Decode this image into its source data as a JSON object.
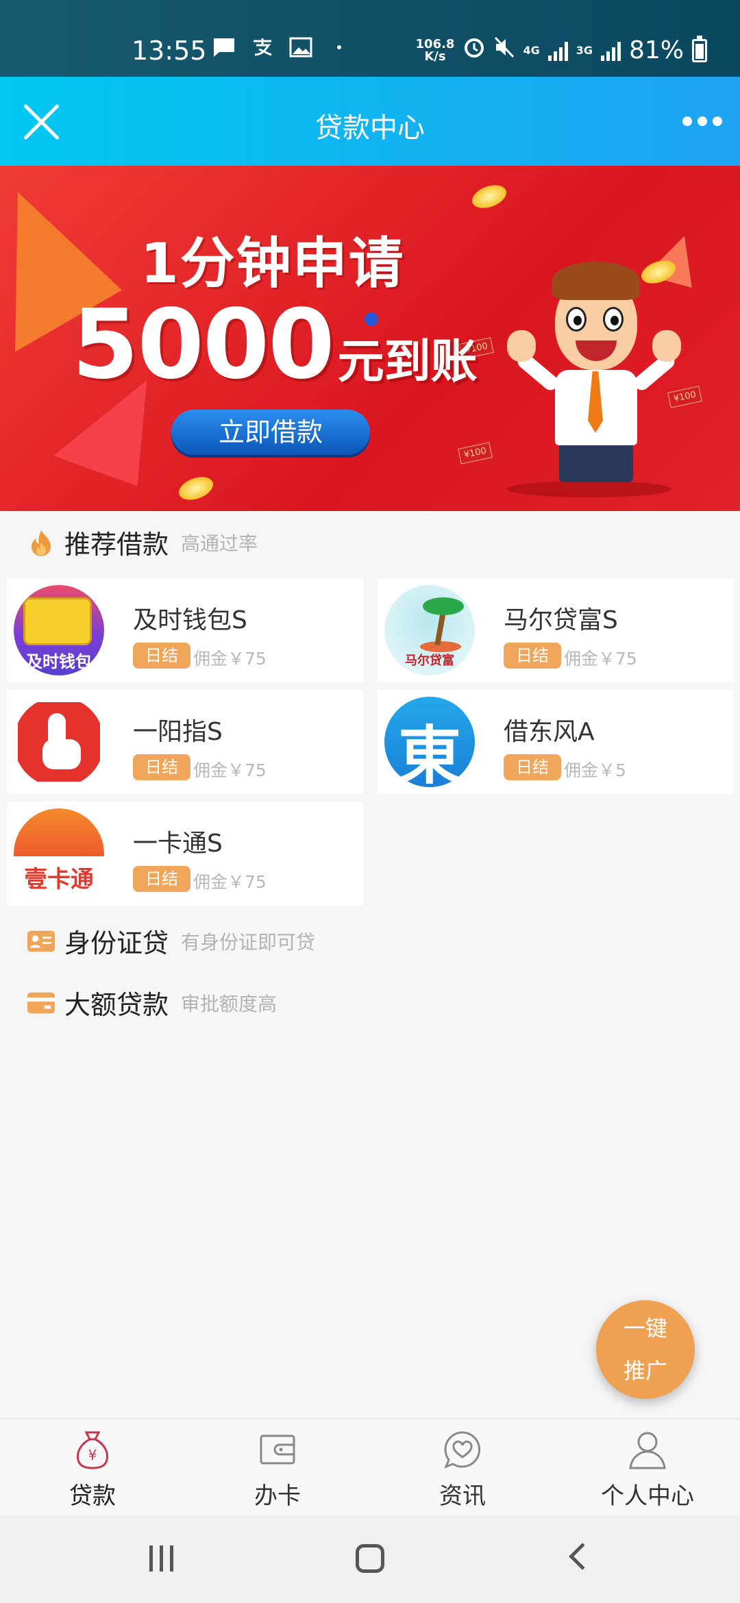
{
  "status_bar": {
    "time": "13:55",
    "net_speed_value": "106.8",
    "net_speed_unit": "K/s",
    "network_4g": "4G",
    "network_3g": "3G",
    "battery": "81%"
  },
  "header": {
    "title": "贷款中心"
  },
  "banner": {
    "line1": "1分钟申请",
    "amount": "5000",
    "line2_suffix": "元到账",
    "button": "立即借款",
    "redpack_label": "¥100"
  },
  "recommended": {
    "title": "推荐借款",
    "subtitle": "高通过率",
    "items": [
      {
        "name": "及时钱包S",
        "tag": "日结",
        "commission": "佣金￥75",
        "logo_text": "及时钱包"
      },
      {
        "name": "马尔贷富S",
        "tag": "日结",
        "commission": "佣金￥75",
        "logo_text": "马尔贷富"
      },
      {
        "name": "一阳指S",
        "tag": "日结",
        "commission": "佣金￥75"
      },
      {
        "name": "借东风A",
        "tag": "日结",
        "commission": "佣金￥5",
        "logo_text": "東"
      },
      {
        "name": "一卡通S",
        "tag": "日结",
        "commission": "佣金￥75",
        "logo_text": "壹卡通"
      }
    ]
  },
  "id_loan": {
    "title": "身份证贷",
    "subtitle": "有身份证即可贷"
  },
  "large_loan": {
    "title": "大额贷款",
    "subtitle": "审批额度高"
  },
  "fab": {
    "line1": "一键",
    "line2": "推广"
  },
  "bottom_nav": {
    "items": [
      {
        "label": "贷款",
        "icon": "money-bag-icon",
        "active": true
      },
      {
        "label": "办卡",
        "icon": "wallet-card-icon",
        "active": false
      },
      {
        "label": "资讯",
        "icon": "heart-chat-icon",
        "active": false
      },
      {
        "label": "个人中心",
        "icon": "person-icon",
        "active": false
      }
    ]
  },
  "colors": {
    "header_start": "#00c8f0",
    "header_end": "#1fa2f2",
    "accent_orange": "#f0a65a",
    "banner_red": "#e0222a",
    "active_nav": "#c8334b"
  }
}
